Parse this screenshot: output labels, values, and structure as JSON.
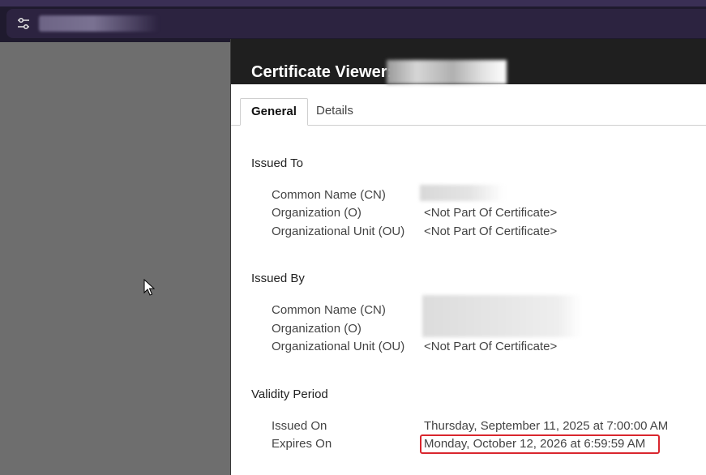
{
  "browser": {
    "tune_icon": "tune-settings-icon",
    "accent_color": "#3a2f55"
  },
  "dialog": {
    "title": "Certificate Viewer:",
    "tabs": [
      {
        "label": "General",
        "selected": true
      },
      {
        "label": "Details",
        "selected": false
      }
    ],
    "issued_to": {
      "heading": "Issued To",
      "rows": [
        {
          "label": "Common Name (CN)",
          "value": ""
        },
        {
          "label": "Organization (O)",
          "value": "<Not Part Of Certificate>"
        },
        {
          "label": "Organizational Unit (OU)",
          "value": "<Not Part Of Certificate>"
        }
      ]
    },
    "issued_by": {
      "heading": "Issued By",
      "rows": [
        {
          "label": "Common Name (CN)",
          "value": ""
        },
        {
          "label": "Organization (O)",
          "value": ""
        },
        {
          "label": "Organizational Unit (OU)",
          "value": "<Not Part Of Certificate>"
        }
      ]
    },
    "validity": {
      "heading": "Validity Period",
      "rows": [
        {
          "label": "Issued On",
          "value": "Thursday, September 11, 2025 at 7:00:00 AM"
        },
        {
          "label": "Expires On",
          "value": "Monday, October 12, 2026 at 6:59:59 AM"
        }
      ],
      "highlight_color": "#d9262e"
    }
  }
}
